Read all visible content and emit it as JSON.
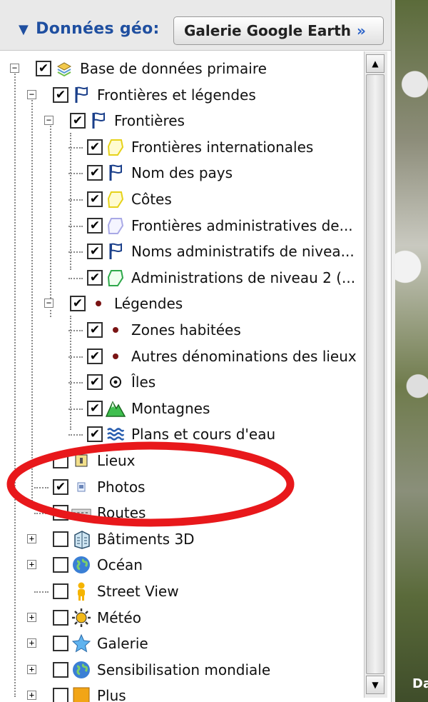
{
  "header": {
    "panel_title": "Données géo:",
    "gallery_button": "Galerie Google Earth",
    "gallery_chevron": "»"
  },
  "tree": [
    {
      "label": "Base de données primaire",
      "checked": true,
      "icon": "layers-icon",
      "expander": "minus"
    },
    {
      "label": "Frontières et légendes",
      "checked": true,
      "icon": "flag-icon",
      "expander": "minus"
    },
    {
      "label": "Frontières",
      "checked": true,
      "icon": "flag-icon",
      "expander": "minus"
    },
    {
      "label": "Frontières internationales",
      "checked": true,
      "icon": "polygon-yellow-icon"
    },
    {
      "label": "Nom des pays",
      "checked": true,
      "icon": "flag-icon"
    },
    {
      "label": "Côtes",
      "checked": true,
      "icon": "polygon-yellow-icon"
    },
    {
      "label": "Frontières administratives de...",
      "checked": true,
      "icon": "polygon-lavender-icon"
    },
    {
      "label": "Noms administratifs de nivea...",
      "checked": true,
      "icon": "flag-icon"
    },
    {
      "label": "Administrations de niveau 2 (...",
      "checked": true,
      "icon": "polygon-green-icon"
    },
    {
      "label": "Légendes",
      "checked": true,
      "icon": "dot-icon",
      "expander": "minus"
    },
    {
      "label": "Zones habitées",
      "checked": true,
      "icon": "dot-icon"
    },
    {
      "label": "Autres dénominations des lieux",
      "checked": true,
      "icon": "dot-icon"
    },
    {
      "label": "Îles",
      "checked": true,
      "icon": "island-icon"
    },
    {
      "label": "Montagnes",
      "checked": true,
      "icon": "mountain-icon"
    },
    {
      "label": "Plans et cours d'eau",
      "checked": true,
      "icon": "water-icon"
    },
    {
      "label": "Lieux",
      "checked": false,
      "icon": "places-icon"
    },
    {
      "label": "Photos",
      "checked": true,
      "icon": "photo-icon"
    },
    {
      "label": "Routes",
      "checked": false,
      "icon": "road-icon"
    },
    {
      "label": "Bâtiments 3D",
      "checked": false,
      "icon": "building-3d-icon",
      "expander": "plus"
    },
    {
      "label": "Océan",
      "checked": false,
      "icon": "globe-icon",
      "expander": "plus"
    },
    {
      "label": "Street View",
      "checked": false,
      "icon": "pegman-icon"
    },
    {
      "label": "Météo",
      "checked": false,
      "icon": "sun-icon",
      "expander": "plus"
    },
    {
      "label": "Galerie",
      "checked": false,
      "icon": "star-icon",
      "expander": "plus"
    },
    {
      "label": "Sensibilisation mondiale",
      "checked": false,
      "icon": "globe-icon",
      "expander": "plus"
    },
    {
      "label": "Plus",
      "checked": false,
      "icon": "more-icon",
      "expander": "plus"
    }
  ],
  "map_text": "Da",
  "colors": {
    "accent": "#1f4fa0",
    "highlight_circle": "#e8181b"
  }
}
